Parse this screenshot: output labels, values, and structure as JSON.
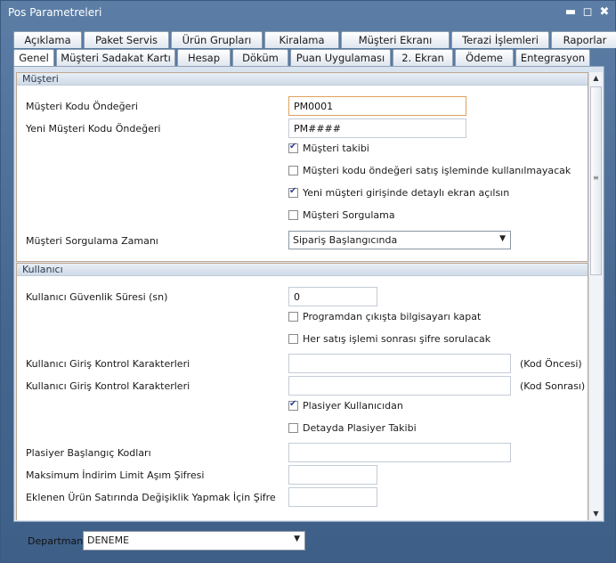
{
  "window": {
    "title": "Pos Parametreleri"
  },
  "tabs_row1": [
    "Açıklama",
    "Paket Servis",
    "Ürün Grupları",
    "Kiralama",
    "Müşteri Ekranı",
    "Terazi İşlemleri",
    "Raporlar"
  ],
  "tabs_row2": [
    "Genel",
    "Müşteri Sadakat Kartı",
    "Hesap",
    "Döküm",
    "Puan Uygulaması",
    "2. Ekran",
    "Ödeme",
    "Entegrasyon"
  ],
  "active_tab": "Genel",
  "musteri": {
    "heading": "Müşteri",
    "code_default_label": "Müşteri Kodu Öndeğeri",
    "code_default_value": "PM0001",
    "new_code_default_label": "Yeni Müşteri Kodu Öndeğeri",
    "new_code_default_value": "PM####",
    "chk_tracking": {
      "label": "Müşteri takibi",
      "checked": true
    },
    "chk_code_unused": {
      "label": "Müşteri kodu öndeğeri satış işleminde kullanılmayacak",
      "checked": false
    },
    "chk_detail_screen": {
      "label": "Yeni müşteri girişinde detaylı ekran açılsın",
      "checked": true
    },
    "chk_query": {
      "label": "Müşteri Sorgulama",
      "checked": false
    },
    "query_time_label": "Müşteri Sorgulama Zamanı",
    "query_time_value": "Sipariş Başlangıcında"
  },
  "kullanici": {
    "heading": "Kullanıcı",
    "security_time_label": "Kullanıcı Güvenlik Süresi (sn)",
    "security_time_value": "0",
    "chk_shutdown": {
      "label": "Programdan çıkışta bilgisayarı kapat",
      "checked": false
    },
    "chk_password_each_sale": {
      "label": "Her satış işlemi sonrası şifre sorulacak",
      "checked": false
    },
    "login_chars_label_1": "Kullanıcı Giriş Kontrol Karakterleri",
    "login_chars_value_1": "",
    "login_chars_suffix_1": "(Kod Öncesi)",
    "login_chars_label_2": "Kullanıcı Giriş Kontrol Karakterleri",
    "login_chars_value_2": "",
    "login_chars_suffix_2": "(Kod Sonrası)",
    "chk_plasiyer_user": {
      "label": "Plasiyer Kullanıcıdan",
      "checked": true
    },
    "chk_plasiyer_detail": {
      "label": "Detayda Plasiyer Takibi",
      "checked": false
    },
    "plasiyer_codes_label": "Plasiyer Başlangıç Kodları",
    "plasiyer_codes_value": "",
    "max_discount_label": "Maksimum İndirim Limit Aşım Şifresi",
    "max_discount_value": "",
    "edit_line_label": "Eklenen Ürün Satırında Değişiklik Yapmak İçin Şifre",
    "edit_line_value": ""
  },
  "footer": {
    "department_label": "Departman",
    "department_value": "DENEME"
  }
}
